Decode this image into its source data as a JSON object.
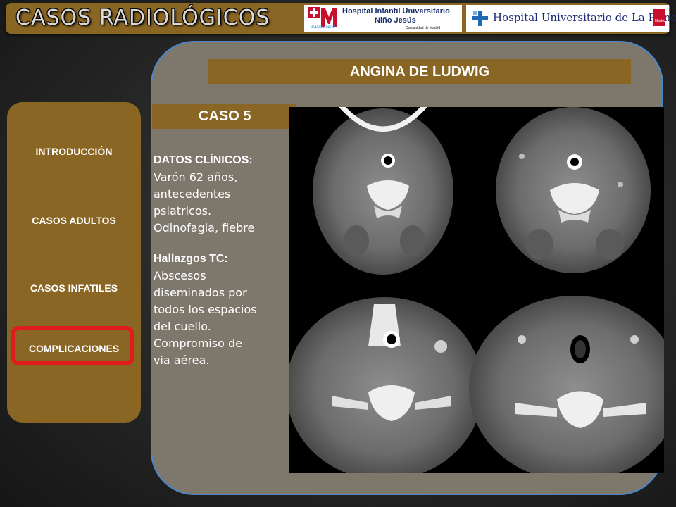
{
  "header": {
    "title": "CASOS RADIOLÓGICOS",
    "logo_left": {
      "mark": "M",
      "line1": "Hospital Infantil Universitario",
      "line2": "Niño Jesús",
      "sub_left": "SaludMadrid",
      "sub_right": "Comunidad de Madrid"
    },
    "logo_right": {
      "name": "Hospital Universitario de La Princesa",
      "flag_text": "Madrid"
    }
  },
  "sidebar": {
    "items": [
      {
        "label": "INTRODUCCIÓN"
      },
      {
        "label": "CASOS ADULTOS"
      },
      {
        "label": "CASOS INFATILES"
      },
      {
        "label": "COMPLICACIONES"
      }
    ],
    "active_index": 3
  },
  "main": {
    "heading": "ANGINA DE LUDWIG",
    "case_label": "CASO 5",
    "clinical_title": "DATOS CLÍNICOS:",
    "clinical_lines": [
      "Varón 62 años,",
      "antecedentes",
      "psiatricos.",
      "Odinofagia, fiebre"
    ],
    "findings_title": "Hallazgos  TC:",
    "findings_lines": [
      "Abscesos",
      "diseminados por",
      "todos los espacios",
      "del cuello.",
      "Compromiso de",
      "via aérea."
    ]
  },
  "colors": {
    "accent_brown": "#8a6624",
    "panel_gray": "#7e776c",
    "panel_border": "#4b86c8",
    "active_ring": "#e01c1c"
  }
}
